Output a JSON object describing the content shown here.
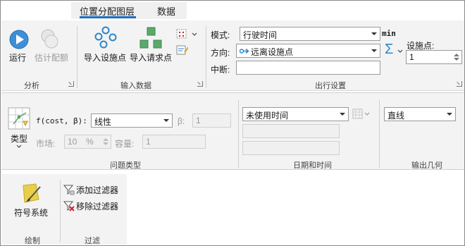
{
  "tabs": [
    {
      "label": "位置分配图层",
      "active": true
    },
    {
      "label": "数据",
      "active": false
    }
  ],
  "analysis_group": {
    "label": "分析",
    "run_label": "运行",
    "estimate_label": "估计配额"
  },
  "input_group": {
    "label": "输入数据",
    "import_facilities_label": "导入设施点",
    "import_demand_label": "导入请求点"
  },
  "travel_group": {
    "label": "出行设置",
    "mode_label": "模式:",
    "mode_value": "行驶时间",
    "unit_label": "min",
    "direction_label": "方向:",
    "direction_value": "远离设施点",
    "barrier_label": "中断:",
    "barrier_value": "",
    "facilities_label": "设施点:",
    "facilities_value": "1"
  },
  "problem_group": {
    "label": "问题类型",
    "type_label": "类型",
    "fcost_label": "f(cost, β):",
    "fcost_value": "线性",
    "beta_label": "β:",
    "beta_value": "1",
    "market_label": "市场:",
    "market_value": "10",
    "market_unit": "%",
    "capacity_label": "容量:",
    "capacity_value": "1"
  },
  "datetime_group": {
    "label": "日期和时间",
    "time_value": "未使用时间",
    "date_value": "",
    "time_of_day_value": ""
  },
  "output_group": {
    "label": "输出几何",
    "geometry_value": "直线"
  },
  "draw_group": {
    "label": "绘制",
    "symbology_label": "符号系统"
  },
  "filter_group": {
    "label": "过滤",
    "add_filter_label": "添加过滤器",
    "remove_filter_label": "移除过滤器"
  },
  "colors": {
    "accent": "#1e6fc4",
    "run_blue": "#3d8fd6",
    "facility_blue": "#2f86c8",
    "demand_green": "#5aa86a",
    "symbology_yellow": "#e8cf4a",
    "remove_red": "#c8262b"
  }
}
